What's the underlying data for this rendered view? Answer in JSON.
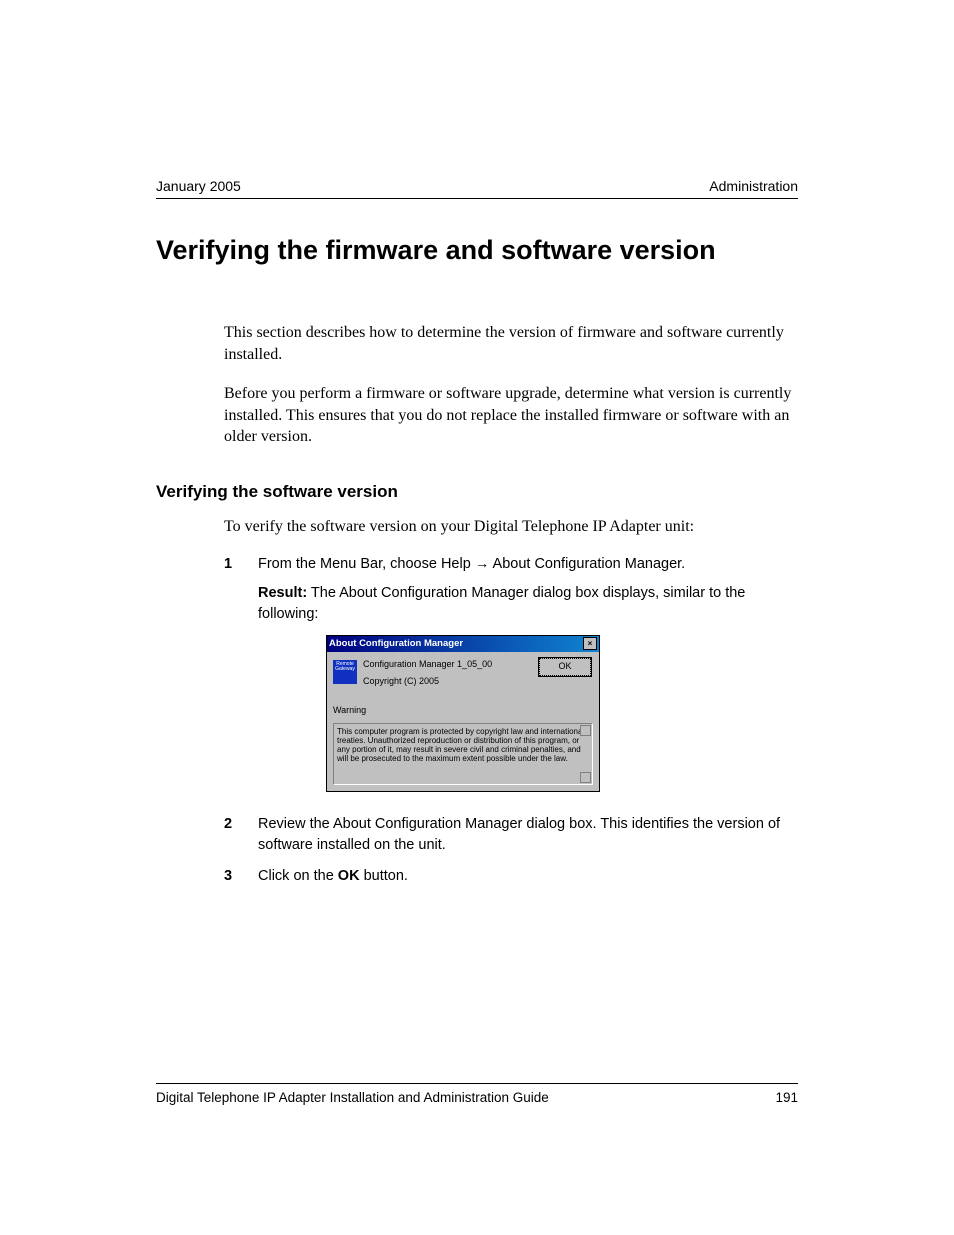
{
  "header": {
    "date": "January 2005",
    "section": "Administration"
  },
  "title": "Verifying the firmware and software version",
  "paragraphs": {
    "p1": "This section describes how to determine the version of firmware and software currently installed.",
    "p2": "Before you perform a firmware or software upgrade, determine what version is currently installed. This ensures that you do not replace the installed firmware or software with an older version."
  },
  "subheading": "Verifying the software version",
  "intro": "To verify the software version on your Digital Telephone IP Adapter unit:",
  "steps": {
    "s1": {
      "num": "1",
      "text_a": "From the Menu Bar, choose Help ",
      "arrow": "→",
      "text_b": " About Configuration Manager.",
      "result_label": "Result:",
      "result_text": " The About Configuration Manager dialog box displays, similar to the following:"
    },
    "s2": {
      "num": "2",
      "text": "Review the About Configuration Manager dialog box. This identifies the version of software installed on the unit."
    },
    "s3": {
      "num": "3",
      "text_a": "Click on the ",
      "bold": "OK",
      "text_b": " button."
    }
  },
  "dialog": {
    "title": "About Configuration Manager",
    "close": "×",
    "logo_line1": "Remote",
    "logo_line2": "Gateway",
    "version": "Configuration Manager  1_05_00",
    "copyright": "Copyright (C) 2005",
    "ok": "OK",
    "warning": "Warning",
    "legal": "This computer program is protected by copyright law and international treaties. Unauthorized reproduction or distribution of this program, or any portion of it, may result in severe civil and criminal penalties, and will be prosecuted to the maximum extent possible under the law."
  },
  "footer": {
    "doc": "Digital Telephone IP Adapter Installation and Administration Guide",
    "page": "191"
  }
}
